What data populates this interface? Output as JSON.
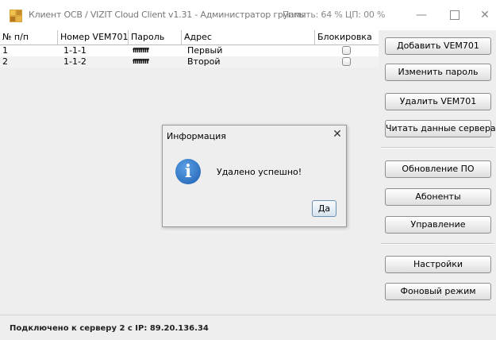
{
  "titlebar": {
    "title": "Клиент ОСВ / VIZIT Cloud Client v1.31 - Администратор группы",
    "status": "Память: 64 %  ЦП: 00 %",
    "minimize": "—",
    "close": "✕"
  },
  "table": {
    "columns": [
      "№ п/п",
      "Номер VEM701",
      "Пароль",
      "Адрес",
      "Блокировка"
    ],
    "rows": [
      {
        "num": "1",
        "vem": "1-1-1",
        "password": "ffffffff",
        "address": "Первый",
        "blocked": false
      },
      {
        "num": "2",
        "vem": "1-1-2",
        "password": "ffffffff",
        "address": "Второй",
        "blocked": false
      }
    ]
  },
  "buttons": {
    "add_vem": "Добавить VEM701",
    "change_password": "Изменить пароль",
    "delete_vem": "Удалить VEM701",
    "read_server": "Читать данные сервера",
    "update_sw": "Обновление ПО",
    "subscribers": "Абоненты",
    "control": "Управление",
    "settings": "Настройки",
    "background_mode": "Фоновый режим"
  },
  "status": {
    "text": "Подключено к серверу 2 с IP:  89.20.136.34"
  },
  "dialog": {
    "title": "Информация",
    "message": "Удалено успешно!",
    "ok": "Да",
    "close": "✕",
    "icon": "info-icon",
    "icon_glyph": "i"
  }
}
